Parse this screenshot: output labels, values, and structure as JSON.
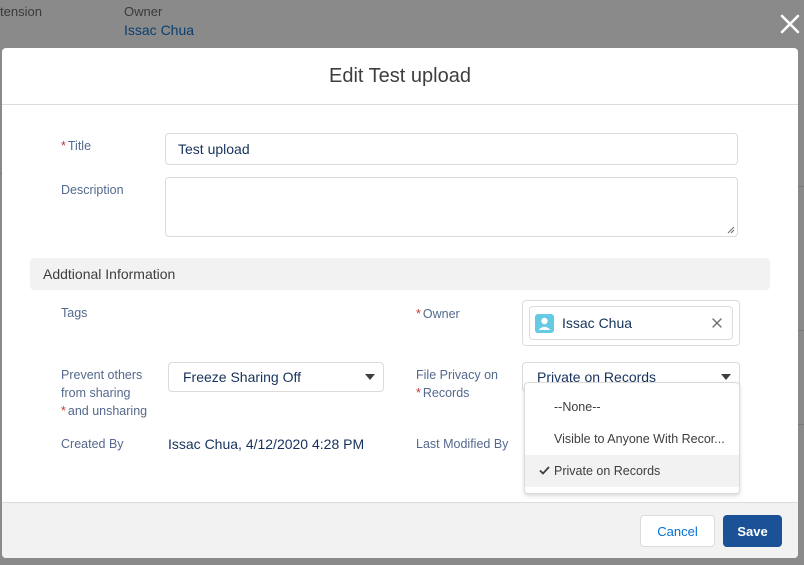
{
  "background": {
    "col1_label": "tension",
    "owner_label": "Owner",
    "owner_value": "Issac Chua"
  },
  "modal": {
    "title": "Edit Test upload",
    "title_field": {
      "required_mark": "*",
      "label": "Title",
      "value": "Test upload"
    },
    "description_field": {
      "label": "Description",
      "value": ""
    },
    "section": {
      "title": "Addtional Information"
    },
    "tags": {
      "label": "Tags"
    },
    "owner": {
      "required_mark": "*",
      "label": "Owner",
      "value": "Issac Chua"
    },
    "prevent_sharing": {
      "label_line1": "Prevent others",
      "label_line2": "from sharing",
      "required_mark": "*",
      "label_line3": "and unsharing",
      "value": "Freeze Sharing Off"
    },
    "file_privacy": {
      "label_line1": "File Privacy on",
      "required_mark": "*",
      "label_line2": "Records",
      "value": "Private on Records",
      "options": [
        {
          "label": "--None--",
          "selected": false
        },
        {
          "label": "Visible to Anyone With Recor...",
          "selected": false
        },
        {
          "label": "Private on Records",
          "selected": true
        }
      ]
    },
    "created_by": {
      "label": "Created By",
      "value": "Issac Chua, 4/12/2020 4:28 PM"
    },
    "last_modified_by": {
      "label": "Last Modified By"
    },
    "footer": {
      "cancel_label": "Cancel",
      "save_label": "Save"
    }
  },
  "colors": {
    "save_button": "#1b5297",
    "link": "#0070d2",
    "required": "#c23934",
    "avatar": "#65cae4",
    "section_bg": "#f3f2f2"
  },
  "icons": {
    "close": "close-icon",
    "remove": "remove-pill-icon",
    "caret": "chevron-down-icon",
    "check": "check-icon",
    "avatar": "user-avatar-icon"
  }
}
